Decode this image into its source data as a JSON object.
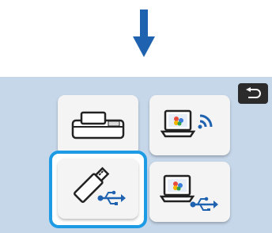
{
  "colors": {
    "screen_bg": "#c6d7ea",
    "accent_blue": "#1f63b0",
    "selection": "#1d9be4",
    "tile_bg": "#f4f4f4",
    "back_button_bg": "#2b2b2b"
  },
  "icons": {
    "down_arrow": "down-arrow-icon",
    "back": "return-arrow-icon",
    "tiles": [
      "cutting-machine-icon",
      "laptop-wireless-icon",
      "usb-flash-drive-icon",
      "laptop-usb-icon"
    ]
  },
  "selection": {
    "selected_tile": "usb-flash-drive-icon"
  }
}
